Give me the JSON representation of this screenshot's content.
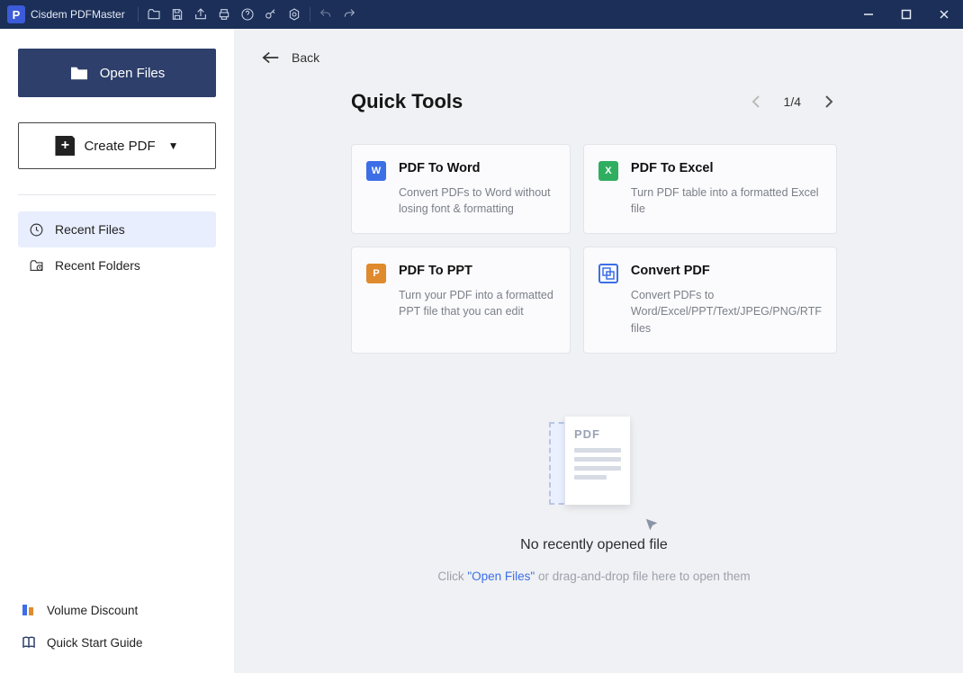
{
  "app": {
    "name": "Cisdem PDFMaster",
    "logo_letter": "P"
  },
  "sidebar": {
    "open_label": "Open Files",
    "create_label": "Create PDF",
    "recent_files_label": "Recent Files",
    "recent_folders_label": "Recent Folders",
    "volume_discount_label": "Volume Discount",
    "quick_start_label": "Quick Start Guide"
  },
  "main": {
    "back_label": "Back",
    "tools_title": "Quick Tools",
    "pager": {
      "current": "1",
      "total": "4",
      "display": "1/4"
    },
    "cards": [
      {
        "title": "PDF To Word",
        "desc": "Convert PDFs to Word without losing font & formatting",
        "icon_letter": "W",
        "icon_color": "#3c6fe6"
      },
      {
        "title": "PDF To Excel",
        "desc": "Turn PDF table into a formatted Excel file",
        "icon_letter": "X",
        "icon_color": "#2fae60"
      },
      {
        "title": "PDF To PPT",
        "desc": "Turn your PDF into a formatted PPT file that you can edit",
        "icon_letter": "P",
        "icon_color": "#e08a2e"
      },
      {
        "title": "Convert PDF",
        "desc": "Convert PDFs to Word/Excel/PPT/Text/JPEG/PNG/RTF files",
        "icon_letter": "",
        "icon_color": "#3c6fe6",
        "is_convert": true
      }
    ],
    "empty": {
      "pdf_label": "PDF",
      "title": "No recently opened file",
      "sub_pre": "Click ",
      "sub_link": "\"Open Files\"",
      "sub_post": " or drag-and-drop file here to open them"
    }
  }
}
